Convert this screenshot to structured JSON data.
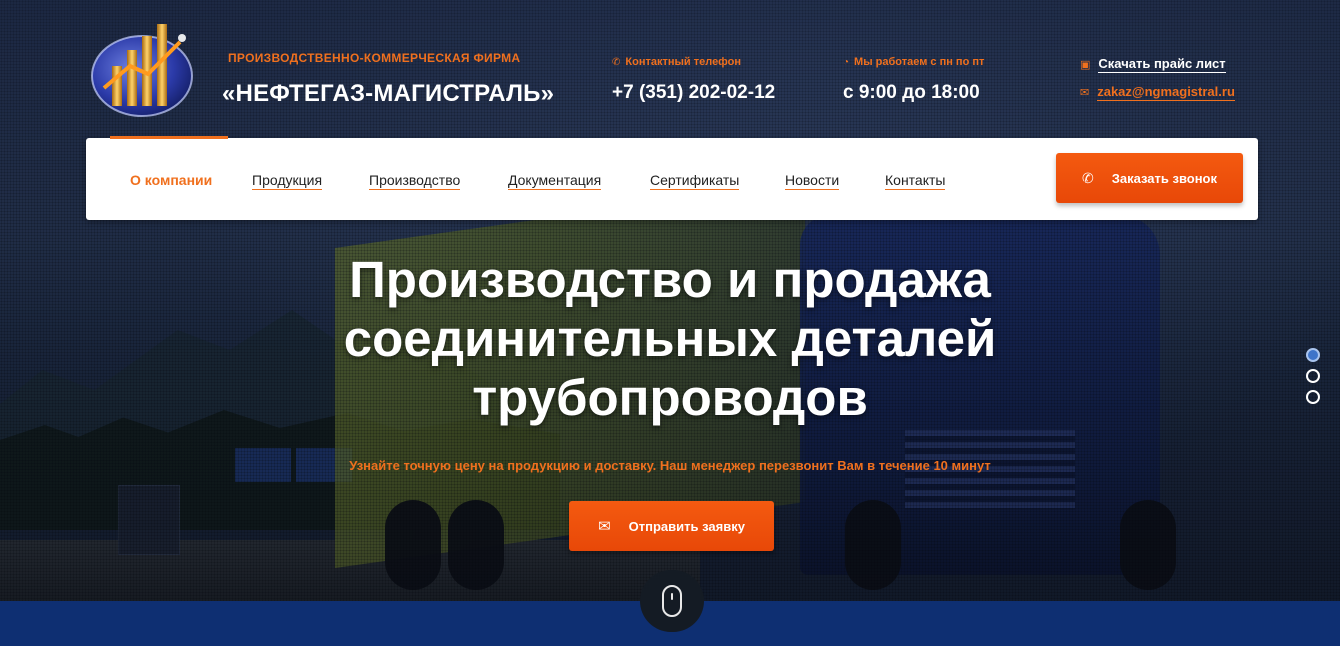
{
  "header": {
    "logo_icon": "oil-pipes-chart-logo",
    "brand_subtitle": "ПРОИЗВОДСТВЕННО-КОММЕРЧЕСКАЯ ФИРМА",
    "brand_name": "«НЕФТЕГАЗ-МАГИСТРАЛЬ»",
    "phone": {
      "label": "Контактный телефон",
      "value": "+7 (351) 202-02-12",
      "icon": "phone-icon"
    },
    "hours": {
      "label": "Мы работаем с пн по пт",
      "value": "с 9:00 до 18:00",
      "icon": "clock-icon"
    },
    "price_list": {
      "label": "Скачать прайс лист",
      "icon": "pdf-icon"
    },
    "email": {
      "label": "zakaz@ngmagistral.ru",
      "icon": "mail-icon"
    }
  },
  "nav": {
    "items": [
      {
        "label": "О компании",
        "active": true
      },
      {
        "label": "Продукция",
        "active": false
      },
      {
        "label": "Производство",
        "active": false
      },
      {
        "label": "Документация",
        "active": false
      },
      {
        "label": "Сертификаты",
        "active": false
      },
      {
        "label": "Новости",
        "active": false
      },
      {
        "label": "Контакты",
        "active": false
      }
    ],
    "call_button": {
      "label": "Заказать звонок",
      "icon": "phone-icon"
    }
  },
  "hero": {
    "headline": "Производство и продажа соединительных деталей трубопроводов",
    "subline": "Узнайте точную цену на продукцию и доставку. Наш менеджер перезвонит Вам в течение 10 минут",
    "cta": {
      "label": "Отправить заявку",
      "icon": "envelope-icon"
    },
    "slides": {
      "count": 3,
      "active": 1
    },
    "scroll_icon": "mouse-icon"
  },
  "colors": {
    "accent": "#f0701e",
    "button": "#f45a10",
    "bottom_bar": "#0e2f72"
  }
}
